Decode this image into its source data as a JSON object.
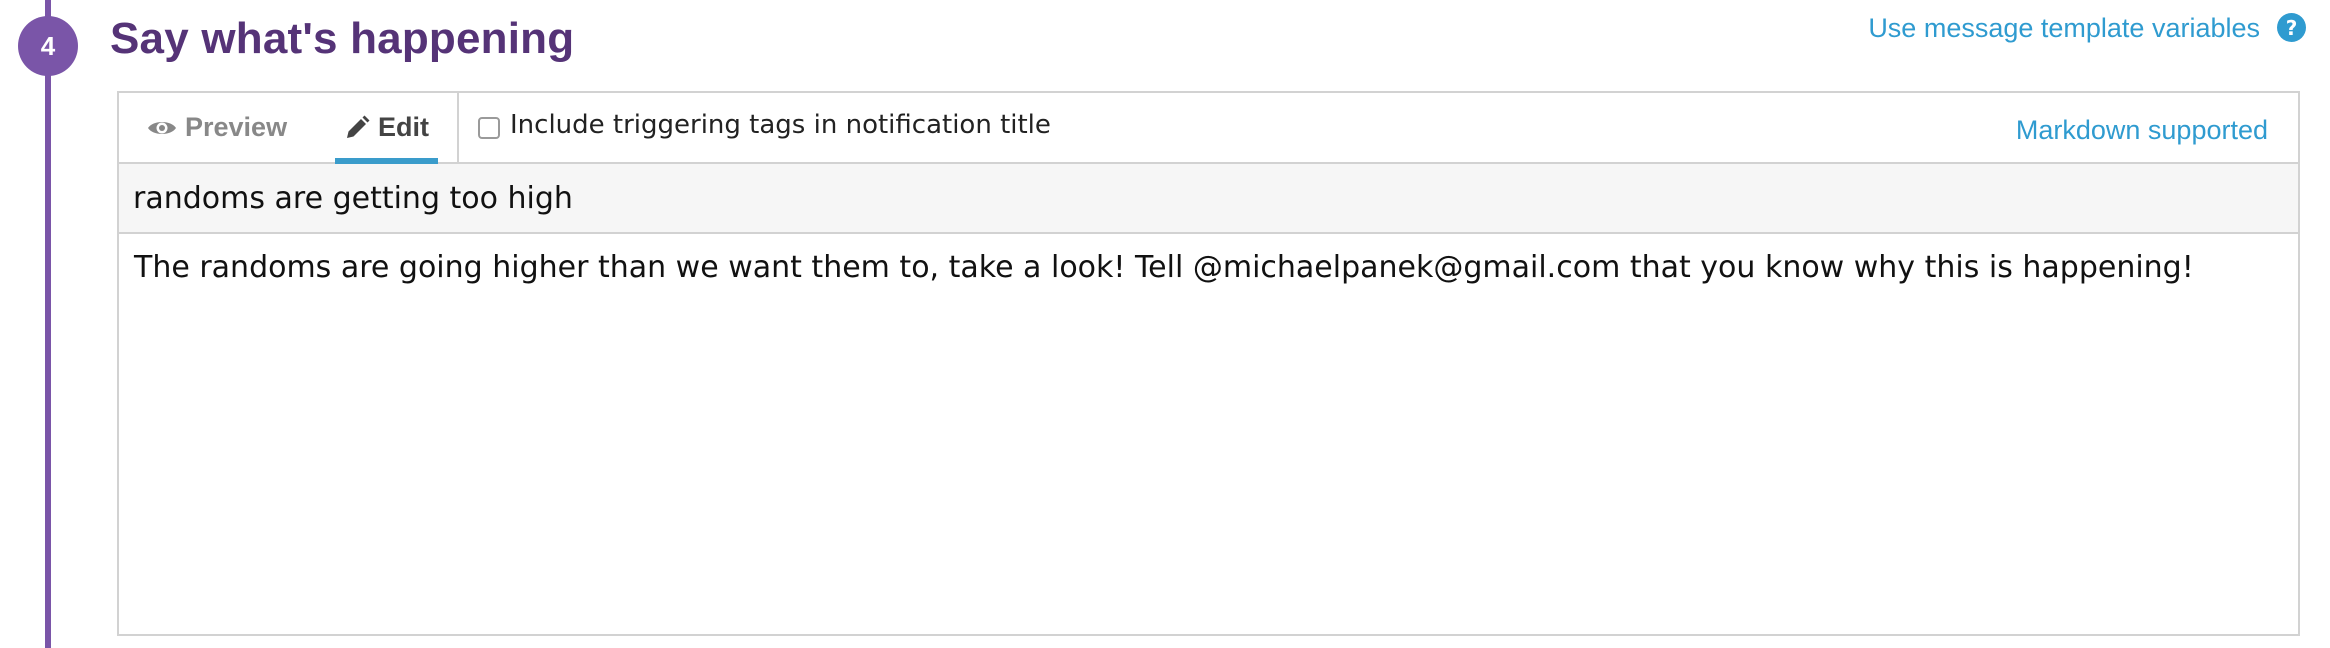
{
  "step": {
    "number": "4",
    "title": "Say what's happening"
  },
  "links": {
    "template_variables": "Use message template variables",
    "help": "?",
    "markdown": "Markdown supported"
  },
  "tabs": {
    "preview": {
      "label": "Preview",
      "icon": "eye-icon"
    },
    "edit": {
      "label": "Edit",
      "icon": "pencil-icon",
      "active": true
    }
  },
  "options": {
    "include_tags_label": "Include triggering tags in notification title",
    "include_tags_checked": false
  },
  "message": {
    "title": "randoms are getting too high",
    "body": "The randoms are going higher than we want them to, take a look! Tell @michaelpanek@gmail.com that you know why this is happening!"
  },
  "colors": {
    "accent_purple": "#7a55a8",
    "title_purple": "#553377",
    "link_blue": "#2f9bd0",
    "tab_underline": "#3a9ccb"
  }
}
